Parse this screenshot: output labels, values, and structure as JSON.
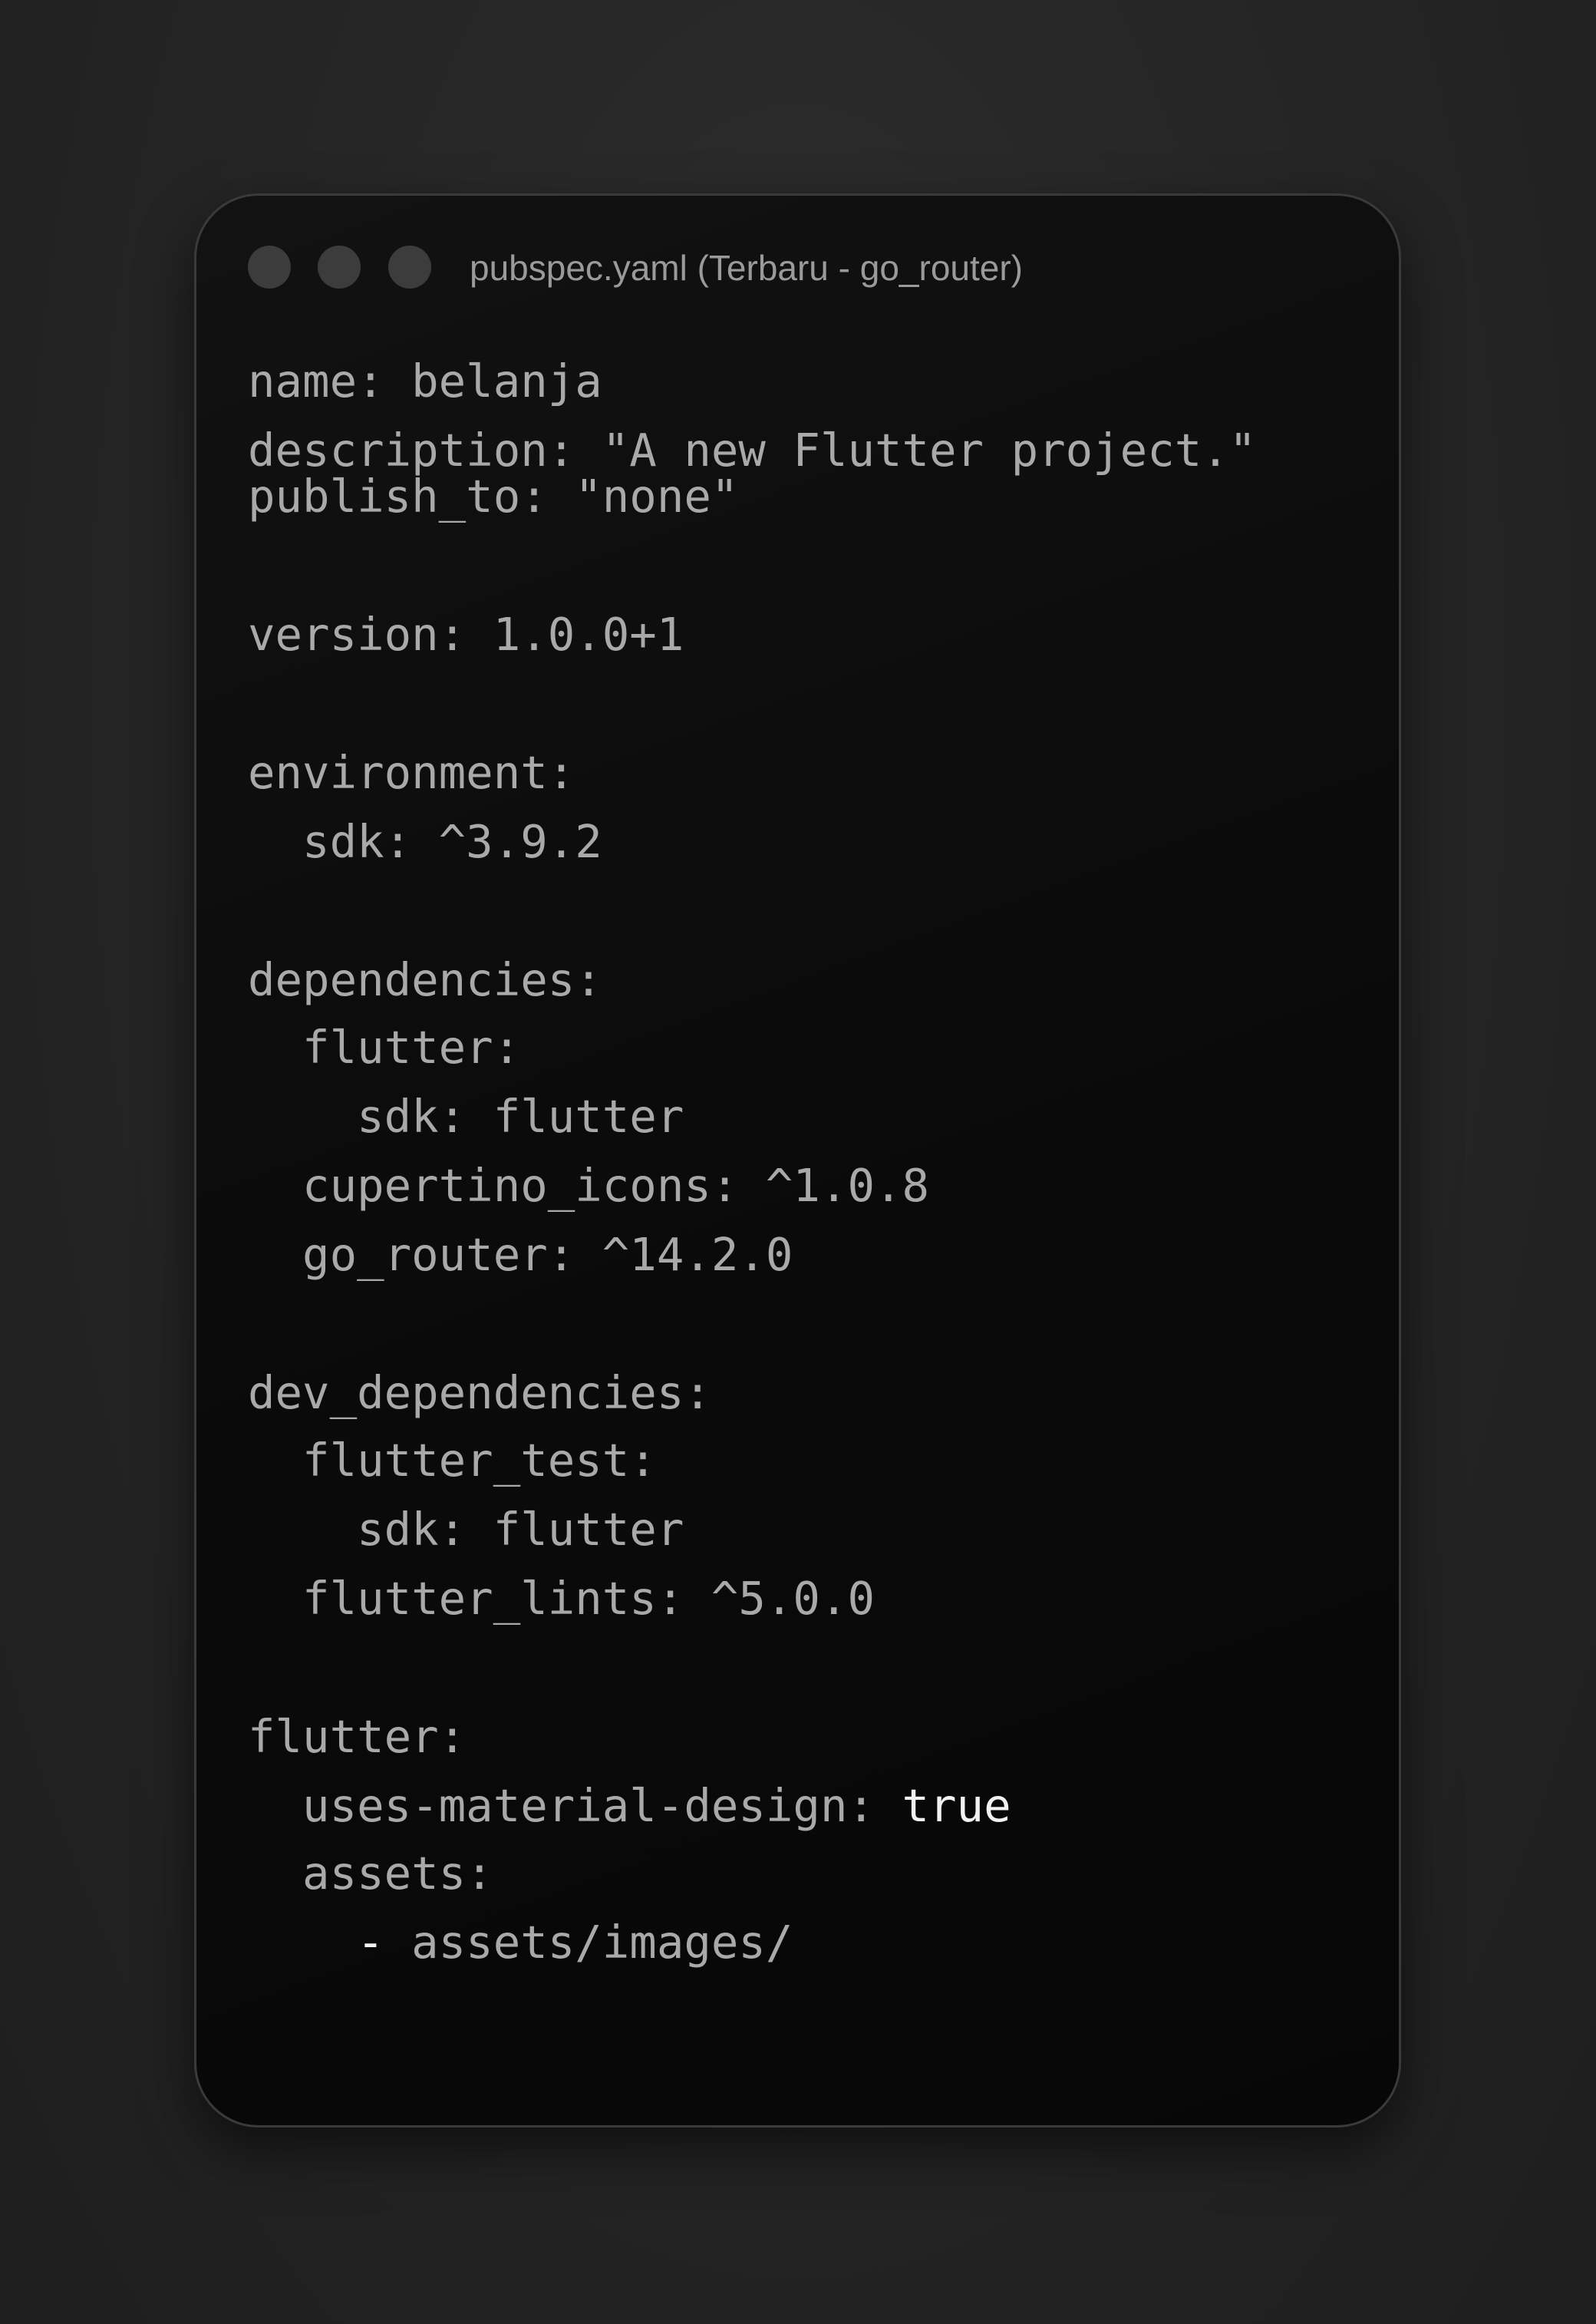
{
  "window": {
    "title": "pubspec.yaml (Terbaru - go_router)",
    "controls": [
      "close",
      "minimize",
      "maximize"
    ]
  },
  "code": {
    "line_name": "name: belanja",
    "line_description": "description: \"A new Flutter project.\"",
    "line_publish_to": "publish_to: \"none\"",
    "line_version": "version: 1.0.0+1",
    "line_environment": "environment:",
    "line_env_sdk": "  sdk: ^3.9.2",
    "line_dependencies": "dependencies:",
    "line_dep_flutter": "  flutter:",
    "line_dep_flutter_sdk": "    sdk: flutter",
    "line_cupertino": "  cupertino_icons: ^1.0.8",
    "line_go_router": "  go_router: ^14.2.0",
    "line_dev_dependencies": "dev_dependencies:",
    "line_flutter_test": "  flutter_test:",
    "line_flutter_test_sdk": "    sdk: flutter",
    "line_flutter_lints": "  flutter_lints: ^5.0.0",
    "line_flutter": "flutter:",
    "line_material_key": "  uses-material-design: ",
    "line_material_value": "true",
    "line_assets": "  assets:",
    "line_asset_dash": "    -",
    "line_asset_path": " assets/images/"
  },
  "colors": {
    "background": "#262626",
    "window": "#0b0b0b",
    "text": "#a9a9a9",
    "highlight": "#f2f2f2",
    "title": "#9a9a9a",
    "dot": "#3c3c3c"
  }
}
